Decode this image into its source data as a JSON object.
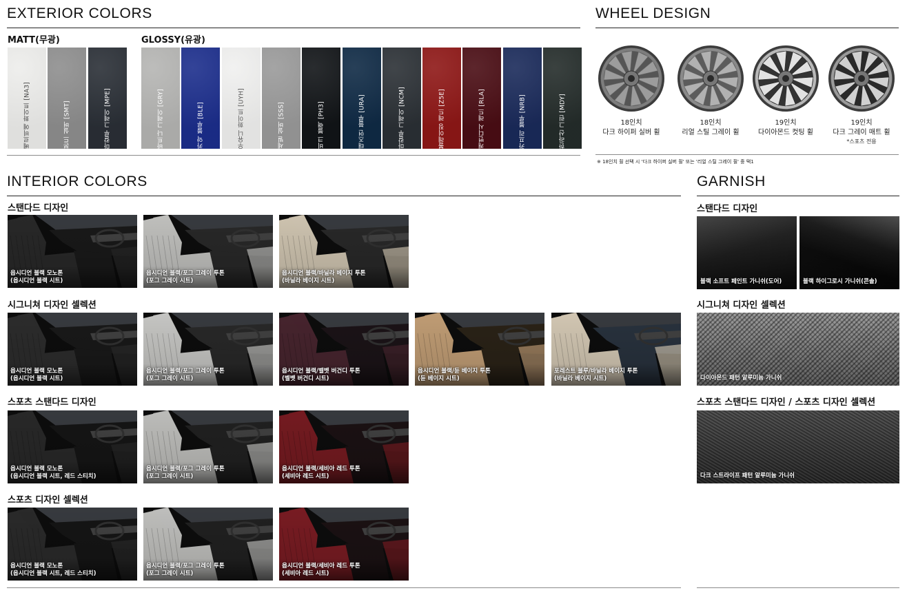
{
  "exterior": {
    "title": "EXTERIOR COLORS",
    "matt_label": "MATT(무광)",
    "glossy_label": "GLOSSY(유광)",
    "matt": [
      {
        "name": "베르비에 화이트 [NA3]",
        "color": "#ededeb",
        "text": "#444444"
      },
      {
        "name": "본드 실버 [SMT]",
        "color": "#8e8e8e",
        "text": "#ffffff"
      },
      {
        "name": "마칼루 그레이 [MPE]",
        "color": "#2a2f36",
        "text": "#ffffff"
      }
    ],
    "glossy": [
      {
        "name": "바트나 그레이 [GRY]",
        "color": "#b5b5b3",
        "text": "#ffffff"
      },
      {
        "name": "카약 블루 [BLE]",
        "color": "#1c2e8c",
        "text": "#ffffff"
      },
      {
        "name": "우유니 화이트 [UYH]",
        "color": "#f0f0ef",
        "text": "#555555"
      },
      {
        "name": "세빌 실버 [SSS]",
        "color": "#9a9a9a",
        "text": "#ffffff"
      },
      {
        "name": "비크 블랙 [PH3]",
        "color": "#111417",
        "text": "#ffffff"
      },
      {
        "name": "태즈먼 블루 [URA]",
        "color": "#0f2a45",
        "text": "#ffffff"
      },
      {
        "name": "마칼루 그레이 [NCM]",
        "color": "#2b3035",
        "text": "#ffffff"
      },
      {
        "name": "볼레이징 레드 [Z5E]",
        "color": "#8e1716",
        "text": "#ffffff"
      },
      {
        "name": "캐번디시 레드 [RLA]",
        "color": "#4a0d14",
        "text": "#ffffff"
      },
      {
        "name": "카프리 블루 [NRB]",
        "color": "#1a2a5a",
        "text": "#ffffff"
      },
      {
        "name": "한라산 그린 [MDY]",
        "color": "#242c2a",
        "text": "#ffffff"
      }
    ]
  },
  "wheel": {
    "title": "WHEEL DESIGN",
    "items": [
      {
        "size": "18인치",
        "name": "다크 하이퍼 실버 휠",
        "note": ""
      },
      {
        "size": "18인치",
        "name": "리얼 스틸 그레이 휠",
        "note": ""
      },
      {
        "size": "19인치",
        "name": "다이아몬드 컷팅 휠",
        "note": ""
      },
      {
        "size": "19인치",
        "name": "다크 그레이 매트 휠",
        "note": "*스포츠 전용"
      }
    ],
    "footnote": "※ 18인치 휠 선택 시 '다크 하이퍼 실버 휠' 또는 '리얼 스틸 그레이 휠' 중 택1"
  },
  "interior": {
    "title": "INTERIOR COLORS",
    "groups": [
      {
        "label": "스탠다드 디자인",
        "items": [
          {
            "line1": "옵시디언 블랙 모노톤",
            "line2": "(옵시디언 블랙 시트)",
            "seat": "#2a2a2a",
            "dash": "#1a1a1a"
          },
          {
            "line1": "옵시디언 블랙/포그 그레이 투톤",
            "line2": "(포그 그레이 시트)",
            "seat": "#c9c9c6",
            "dash": "#2a2a2a"
          },
          {
            "line1": "옵시디언 블랙/바닐라 베이지 투톤",
            "line2": "(바닐라 베이지 시트)",
            "seat": "#d8cdb8",
            "dash": "#2a2a2a"
          }
        ]
      },
      {
        "label": "시그니쳐 디자인 셀렉션",
        "items": [
          {
            "line1": "옵시디언 블랙 모노톤",
            "line2": "(옵시디언 블랙 시트)",
            "seat": "#2e2e2e",
            "dash": "#1a1a1a"
          },
          {
            "line1": "옵시디언 블랙/포그 그레이 투톤",
            "line2": "(포그 그레이 시트)",
            "seat": "#cfcfcc",
            "dash": "#2a2a2a"
          },
          {
            "line1": "옵시디언 블랙/벨벳 버건디 투톤",
            "line2": "(벨벳 버건디 시트)",
            "seat": "#4a2630",
            "dash": "#1c1418"
          },
          {
            "line1": "옵시디언 블랙/듄 베이지 투톤",
            "line2": "(듄 베이지 시트)",
            "seat": "#c9a47a",
            "dash": "#2c2418"
          },
          {
            "line1": "포레스트 블루/바닐라 베이지 투톤",
            "line2": "(바닐라 베이지 시트)",
            "seat": "#dcd0bb",
            "dash": "#2a3440"
          }
        ]
      },
      {
        "label": "스포츠 스탠다드 디자인",
        "items": [
          {
            "line1": "옵시디언 블랙 모노톤",
            "line2": "(옵시디언 블랙 시트, 레드 스티치)",
            "seat": "#2a2a2a",
            "dash": "#161616"
          },
          {
            "line1": "옵시디언 블랙/포그 그레이 투톤",
            "line2": "(포그 그레이 시트)",
            "seat": "#c6c6c3",
            "dash": "#222222"
          },
          {
            "line1": "옵시디언 블랙/세비아 레드 투톤",
            "line2": "(세비아 레드 시트)",
            "seat": "#7a1c22",
            "dash": "#1c1214"
          }
        ]
      },
      {
        "label": "스포츠 디자인 셀렉션",
        "items": [
          {
            "line1": "옵시디언 블랙 모노톤",
            "line2": "(옵시디언 블랙 시트, 레드 스티치)",
            "seat": "#2c2c2c",
            "dash": "#161616"
          },
          {
            "line1": "옵시디언 블랙/포그 그레이 투톤",
            "line2": "(포그 그레이 시트)",
            "seat": "#c8c8c5",
            "dash": "#222222"
          },
          {
            "line1": "옵시디언 블랙/세비아 레드 투톤",
            "line2": "(세비아 레드 시트)",
            "seat": "#7e1d24",
            "dash": "#1c1214"
          }
        ]
      }
    ]
  },
  "garnish": {
    "title": "GARNISH",
    "groups": [
      {
        "label": "스탠다드 디자인",
        "items": [
          {
            "caption": "블랙 소프트 페인트 가니쉬(도어)"
          },
          {
            "caption": "블랙 하이그로시 가니쉬(콘솔)"
          }
        ]
      },
      {
        "label": "시그니쳐 디자인 셀렉션",
        "items": [
          {
            "caption": "다이아몬드 패턴 알루미늄 가니쉬"
          }
        ]
      },
      {
        "label": "스포츠 스탠다드 디자인 / 스포츠 디자인 셀렉션",
        "items": [
          {
            "caption": "다크 스트라이프 패턴 알루미늄 가니쉬"
          }
        ]
      }
    ]
  }
}
